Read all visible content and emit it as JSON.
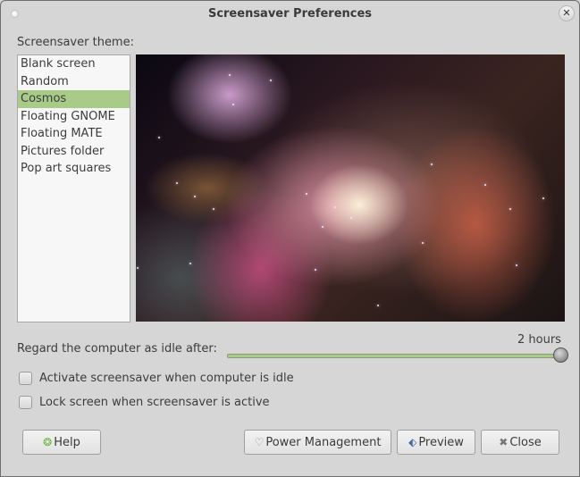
{
  "window": {
    "title": "Screensaver Preferences",
    "menu_icon": "window-menu-dot-icon",
    "close_icon": "close-icon",
    "close_glyph": "✕"
  },
  "theme": {
    "label": "Screensaver theme:",
    "items": [
      {
        "label": "Blank screen",
        "selected": false
      },
      {
        "label": "Random",
        "selected": false
      },
      {
        "label": "Cosmos",
        "selected": true
      },
      {
        "label": "Floating GNOME",
        "selected": false
      },
      {
        "label": "Floating MATE",
        "selected": false
      },
      {
        "label": "Pictures folder",
        "selected": false
      },
      {
        "label": "Pop art squares",
        "selected": false
      }
    ],
    "selected_color": "#a9cb88"
  },
  "preview": {
    "description": "Cosmos theme preview: Orion Nebula image"
  },
  "idle": {
    "label": "Regard the computer as idle after:",
    "value_text": "2 hours",
    "slider_fraction": 1.0,
    "track_color": "#a9cb88"
  },
  "options": {
    "activate": {
      "label": "Activate screensaver when computer is idle",
      "checked": false
    },
    "lock": {
      "label": "Lock screen when screensaver is active",
      "checked": false
    }
  },
  "buttons": {
    "help": {
      "label": "Help",
      "icon": "help-lifebuoy-icon",
      "glyph": "❂"
    },
    "power": {
      "label": "Power Management",
      "icon": "power-management-icon",
      "glyph": "♡"
    },
    "preview": {
      "label": "Preview",
      "icon": "preview-fullscreen-icon",
      "glyph": "⬖"
    },
    "close": {
      "label": "Close",
      "icon": "close-icon",
      "glyph": "✖"
    }
  }
}
